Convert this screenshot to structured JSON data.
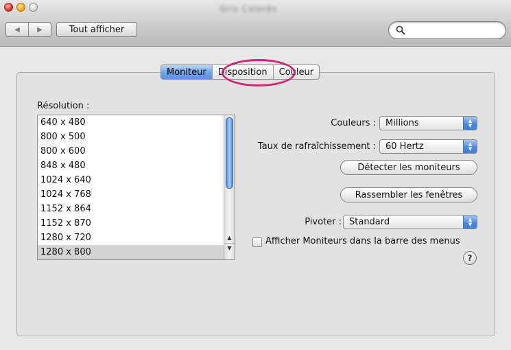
{
  "window": {
    "title": "Gris Colorés"
  },
  "toolbar": {
    "back_glyph": "◀",
    "forward_glyph": "▶",
    "show_all_label": "Tout afficher",
    "search": {
      "value": "",
      "placeholder": "",
      "icon": "search-icon"
    }
  },
  "tabs": [
    {
      "label": "Moniteur",
      "selected": true
    },
    {
      "label": "Disposition",
      "selected": false
    },
    {
      "label": "Couleur",
      "selected": false
    }
  ],
  "colors": {
    "accent": "#5b94de",
    "annotation_ring": "#d6246e"
  },
  "resolution": {
    "label": "Résolution :",
    "items": [
      "640 x 480",
      "800 x 500",
      "800 x 600",
      "848 x 480",
      "1024 x 640",
      "1024 x 768",
      "1152 x 864",
      "1152 x 870",
      "1280 x 720",
      "1280 x 800"
    ],
    "selected": "1280 x 800"
  },
  "colors_row": {
    "label": "Couleurs :",
    "value": "Millions"
  },
  "refresh_row": {
    "label": "Taux de rafraîchissement :",
    "value": "60 Hertz"
  },
  "buttons": {
    "detect": "Détecter les moniteurs",
    "gather": "Rassembler les fenêtres"
  },
  "rotate_row": {
    "label": "Pivoter :",
    "value": "Standard"
  },
  "menubar_checkbox": {
    "label": "Afficher Moniteurs dans la barre des menus",
    "checked": false
  },
  "help": {
    "glyph": "?"
  }
}
